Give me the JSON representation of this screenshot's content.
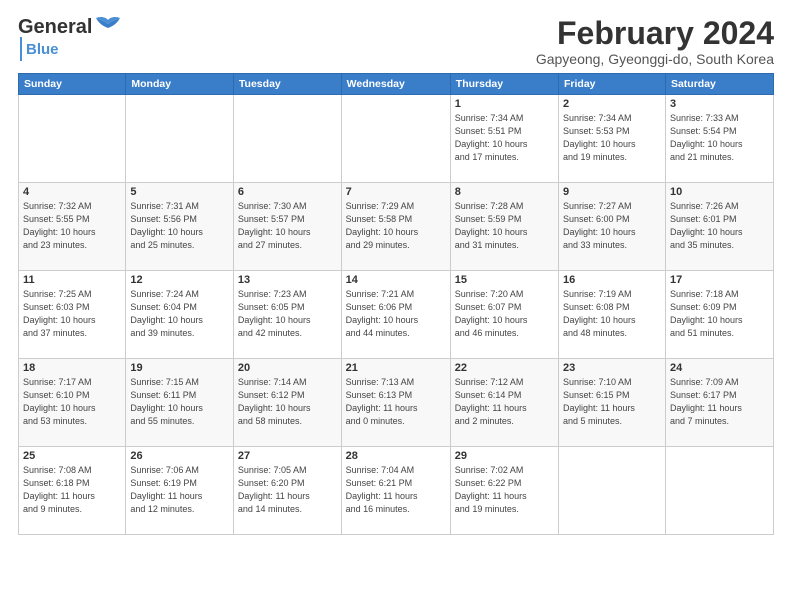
{
  "header": {
    "logo_general": "General",
    "logo_blue": "Blue",
    "main_title": "February 2024",
    "subtitle": "Gapyeong, Gyeonggi-do, South Korea"
  },
  "days_of_week": [
    "Sunday",
    "Monday",
    "Tuesday",
    "Wednesday",
    "Thursday",
    "Friday",
    "Saturday"
  ],
  "weeks": [
    [
      {
        "day": "",
        "info": ""
      },
      {
        "day": "",
        "info": ""
      },
      {
        "day": "",
        "info": ""
      },
      {
        "day": "",
        "info": ""
      },
      {
        "day": "1",
        "info": "Sunrise: 7:34 AM\nSunset: 5:51 PM\nDaylight: 10 hours\nand 17 minutes."
      },
      {
        "day": "2",
        "info": "Sunrise: 7:34 AM\nSunset: 5:53 PM\nDaylight: 10 hours\nand 19 minutes."
      },
      {
        "day": "3",
        "info": "Sunrise: 7:33 AM\nSunset: 5:54 PM\nDaylight: 10 hours\nand 21 minutes."
      }
    ],
    [
      {
        "day": "4",
        "info": "Sunrise: 7:32 AM\nSunset: 5:55 PM\nDaylight: 10 hours\nand 23 minutes."
      },
      {
        "day": "5",
        "info": "Sunrise: 7:31 AM\nSunset: 5:56 PM\nDaylight: 10 hours\nand 25 minutes."
      },
      {
        "day": "6",
        "info": "Sunrise: 7:30 AM\nSunset: 5:57 PM\nDaylight: 10 hours\nand 27 minutes."
      },
      {
        "day": "7",
        "info": "Sunrise: 7:29 AM\nSunset: 5:58 PM\nDaylight: 10 hours\nand 29 minutes."
      },
      {
        "day": "8",
        "info": "Sunrise: 7:28 AM\nSunset: 5:59 PM\nDaylight: 10 hours\nand 31 minutes."
      },
      {
        "day": "9",
        "info": "Sunrise: 7:27 AM\nSunset: 6:00 PM\nDaylight: 10 hours\nand 33 minutes."
      },
      {
        "day": "10",
        "info": "Sunrise: 7:26 AM\nSunset: 6:01 PM\nDaylight: 10 hours\nand 35 minutes."
      }
    ],
    [
      {
        "day": "11",
        "info": "Sunrise: 7:25 AM\nSunset: 6:03 PM\nDaylight: 10 hours\nand 37 minutes."
      },
      {
        "day": "12",
        "info": "Sunrise: 7:24 AM\nSunset: 6:04 PM\nDaylight: 10 hours\nand 39 minutes."
      },
      {
        "day": "13",
        "info": "Sunrise: 7:23 AM\nSunset: 6:05 PM\nDaylight: 10 hours\nand 42 minutes."
      },
      {
        "day": "14",
        "info": "Sunrise: 7:21 AM\nSunset: 6:06 PM\nDaylight: 10 hours\nand 44 minutes."
      },
      {
        "day": "15",
        "info": "Sunrise: 7:20 AM\nSunset: 6:07 PM\nDaylight: 10 hours\nand 46 minutes."
      },
      {
        "day": "16",
        "info": "Sunrise: 7:19 AM\nSunset: 6:08 PM\nDaylight: 10 hours\nand 48 minutes."
      },
      {
        "day": "17",
        "info": "Sunrise: 7:18 AM\nSunset: 6:09 PM\nDaylight: 10 hours\nand 51 minutes."
      }
    ],
    [
      {
        "day": "18",
        "info": "Sunrise: 7:17 AM\nSunset: 6:10 PM\nDaylight: 10 hours\nand 53 minutes."
      },
      {
        "day": "19",
        "info": "Sunrise: 7:15 AM\nSunset: 6:11 PM\nDaylight: 10 hours\nand 55 minutes."
      },
      {
        "day": "20",
        "info": "Sunrise: 7:14 AM\nSunset: 6:12 PM\nDaylight: 10 hours\nand 58 minutes."
      },
      {
        "day": "21",
        "info": "Sunrise: 7:13 AM\nSunset: 6:13 PM\nDaylight: 11 hours\nand 0 minutes."
      },
      {
        "day": "22",
        "info": "Sunrise: 7:12 AM\nSunset: 6:14 PM\nDaylight: 11 hours\nand 2 minutes."
      },
      {
        "day": "23",
        "info": "Sunrise: 7:10 AM\nSunset: 6:15 PM\nDaylight: 11 hours\nand 5 minutes."
      },
      {
        "day": "24",
        "info": "Sunrise: 7:09 AM\nSunset: 6:17 PM\nDaylight: 11 hours\nand 7 minutes."
      }
    ],
    [
      {
        "day": "25",
        "info": "Sunrise: 7:08 AM\nSunset: 6:18 PM\nDaylight: 11 hours\nand 9 minutes."
      },
      {
        "day": "26",
        "info": "Sunrise: 7:06 AM\nSunset: 6:19 PM\nDaylight: 11 hours\nand 12 minutes."
      },
      {
        "day": "27",
        "info": "Sunrise: 7:05 AM\nSunset: 6:20 PM\nDaylight: 11 hours\nand 14 minutes."
      },
      {
        "day": "28",
        "info": "Sunrise: 7:04 AM\nSunset: 6:21 PM\nDaylight: 11 hours\nand 16 minutes."
      },
      {
        "day": "29",
        "info": "Sunrise: 7:02 AM\nSunset: 6:22 PM\nDaylight: 11 hours\nand 19 minutes."
      },
      {
        "day": "",
        "info": ""
      },
      {
        "day": "",
        "info": ""
      }
    ]
  ]
}
